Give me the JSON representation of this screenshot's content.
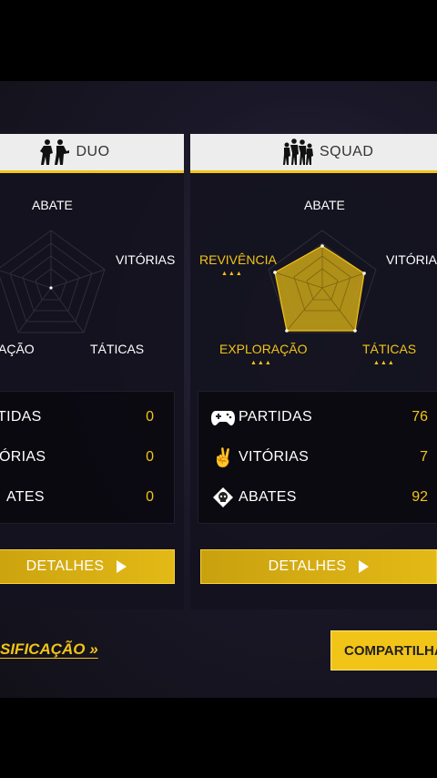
{
  "cards": [
    {
      "mode": "DUO",
      "mode_icon": "duo-soldiers-icon",
      "axes": {
        "abate": "ABATE",
        "vitorias": "VITÓRIAS",
        "taticas": "TÁTICAS",
        "exploracao": "AÇÃO",
        "revivencia": ""
      },
      "stats": [
        {
          "label": "TIDAS",
          "value": "0"
        },
        {
          "label": "ÓRIAS",
          "value": "0"
        },
        {
          "label": "ATES",
          "value": "0"
        }
      ],
      "details_label": "DETALHES"
    },
    {
      "mode": "SQUAD",
      "mode_icon": "squad-soldiers-icon",
      "axes": {
        "abate": "ABATE",
        "vitorias": "VITÓRIAS",
        "taticas": "TÁTICAS",
        "exploracao": "EXPLORAÇÃO",
        "revivencia": "REVIVÊNCIA"
      },
      "highlighted_axes": [
        "REVIVÊNCIA",
        "TÁTICAS",
        "EXPLORAÇÃO"
      ],
      "stats": [
        {
          "label": "PARTIDAS",
          "value": "76",
          "icon": "gamepad-icon"
        },
        {
          "label": "VITÓRIAS",
          "value": "7",
          "icon": "victory-hand-icon"
        },
        {
          "label": "ABATES",
          "value": "92",
          "icon": "skull-badge-icon"
        }
      ],
      "details_label": "DETALHES"
    }
  ],
  "footer": {
    "rank_link": "SIFICAÇÃO »",
    "share_label": "COMPARTILHA"
  },
  "colors": {
    "accent": "#f2c417",
    "panel": "#14121e",
    "header": "#ededed"
  }
}
